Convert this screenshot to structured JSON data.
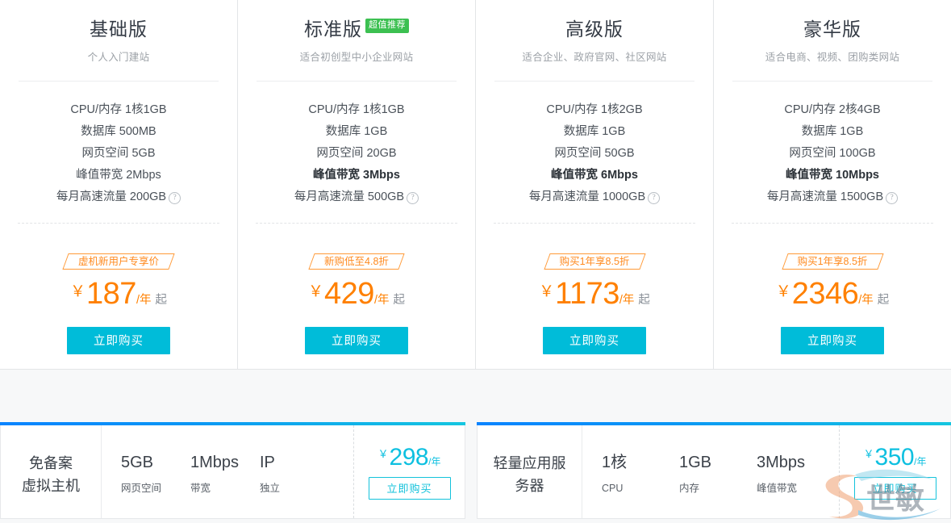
{
  "plans": [
    {
      "title": "基础版",
      "badge": "",
      "subtitle": "个人入门建站",
      "specs": [
        {
          "text": "CPU/内存 1核1GB",
          "bold": false,
          "help": false
        },
        {
          "text": "数据库 500MB",
          "bold": false,
          "help": false
        },
        {
          "text": "网页空间 5GB",
          "bold": false,
          "help": false
        },
        {
          "text": "峰值带宽 2Mbps",
          "bold": false,
          "help": false
        },
        {
          "text": "每月高速流量 200GB",
          "bold": false,
          "help": true
        }
      ],
      "promo_tag": "虚机新用户专享价",
      "currency": "￥",
      "price": "187",
      "period": "/年",
      "from": "起",
      "buy_label": "立即购买"
    },
    {
      "title": "标准版",
      "badge": "超值推荐",
      "subtitle": "适合初创型中小企业网站",
      "specs": [
        {
          "text": "CPU/内存 1核1GB",
          "bold": false,
          "help": false
        },
        {
          "text": "数据库 1GB",
          "bold": false,
          "help": false
        },
        {
          "text": "网页空间 20GB",
          "bold": false,
          "help": false
        },
        {
          "text": "峰值带宽 3Mbps",
          "bold": true,
          "help": false
        },
        {
          "text": "每月高速流量 500GB",
          "bold": false,
          "help": true
        }
      ],
      "promo_tag": "新购低至4.8折",
      "currency": "￥",
      "price": "429",
      "period": "/年",
      "from": "起",
      "buy_label": "立即购买"
    },
    {
      "title": "高级版",
      "badge": "",
      "subtitle": "适合企业、政府官网、社区网站",
      "specs": [
        {
          "text": "CPU/内存 1核2GB",
          "bold": false,
          "help": false
        },
        {
          "text": "数据库 1GB",
          "bold": false,
          "help": false
        },
        {
          "text": "网页空间 50GB",
          "bold": false,
          "help": false
        },
        {
          "text": "峰值带宽 6Mbps",
          "bold": true,
          "help": false
        },
        {
          "text": "每月高速流量 1000GB",
          "bold": false,
          "help": true
        }
      ],
      "promo_tag": "购买1年享8.5折",
      "currency": "￥",
      "price": "1173",
      "period": "/年",
      "from": "起",
      "buy_label": "立即购买"
    },
    {
      "title": "豪华版",
      "badge": "",
      "subtitle": "适合电商、视频、团购类网站",
      "specs": [
        {
          "text": "CPU/内存 2核4GB",
          "bold": false,
          "help": false
        },
        {
          "text": "数据库 1GB",
          "bold": false,
          "help": false
        },
        {
          "text": "网页空间 100GB",
          "bold": false,
          "help": false
        },
        {
          "text": "峰值带宽 10Mbps",
          "bold": true,
          "help": false
        },
        {
          "text": "每月高速流量 1500GB",
          "bold": false,
          "help": true
        }
      ],
      "promo_tag": "购买1年享8.5折",
      "currency": "￥",
      "price": "2346",
      "period": "/年",
      "from": "起",
      "buy_label": "立即购买"
    }
  ],
  "banners": [
    {
      "name": "免备案\n虚拟主机",
      "name_line1": "免备案",
      "name_line2": "虚拟主机",
      "specs": [
        {
          "value": "5GB",
          "label": "网页空间"
        },
        {
          "value": "1Mbps",
          "label": "带宽"
        },
        {
          "value": "IP",
          "label": "独立"
        }
      ],
      "currency": "￥",
      "price": "298",
      "period": "/年",
      "buy_label": "立即购买"
    },
    {
      "name": "轻量应用服\n务器",
      "name_line1": "轻量应用服",
      "name_line2": "务器",
      "specs": [
        {
          "value": "1核",
          "label": "CPU"
        },
        {
          "value": "1GB",
          "label": "内存"
        },
        {
          "value": "3Mbps",
          "label": "峰值带宽"
        }
      ],
      "currency": "￥",
      "price": "350",
      "period": "/年",
      "buy_label": "立即购买"
    }
  ],
  "watermark": {
    "text": "S"
  },
  "colors": {
    "accent_orange": "#ff8000",
    "accent_cyan": "#00bcd9",
    "badge_green": "#3cc051",
    "text_dark": "#333a44",
    "text_muted": "#9ba0a6"
  }
}
